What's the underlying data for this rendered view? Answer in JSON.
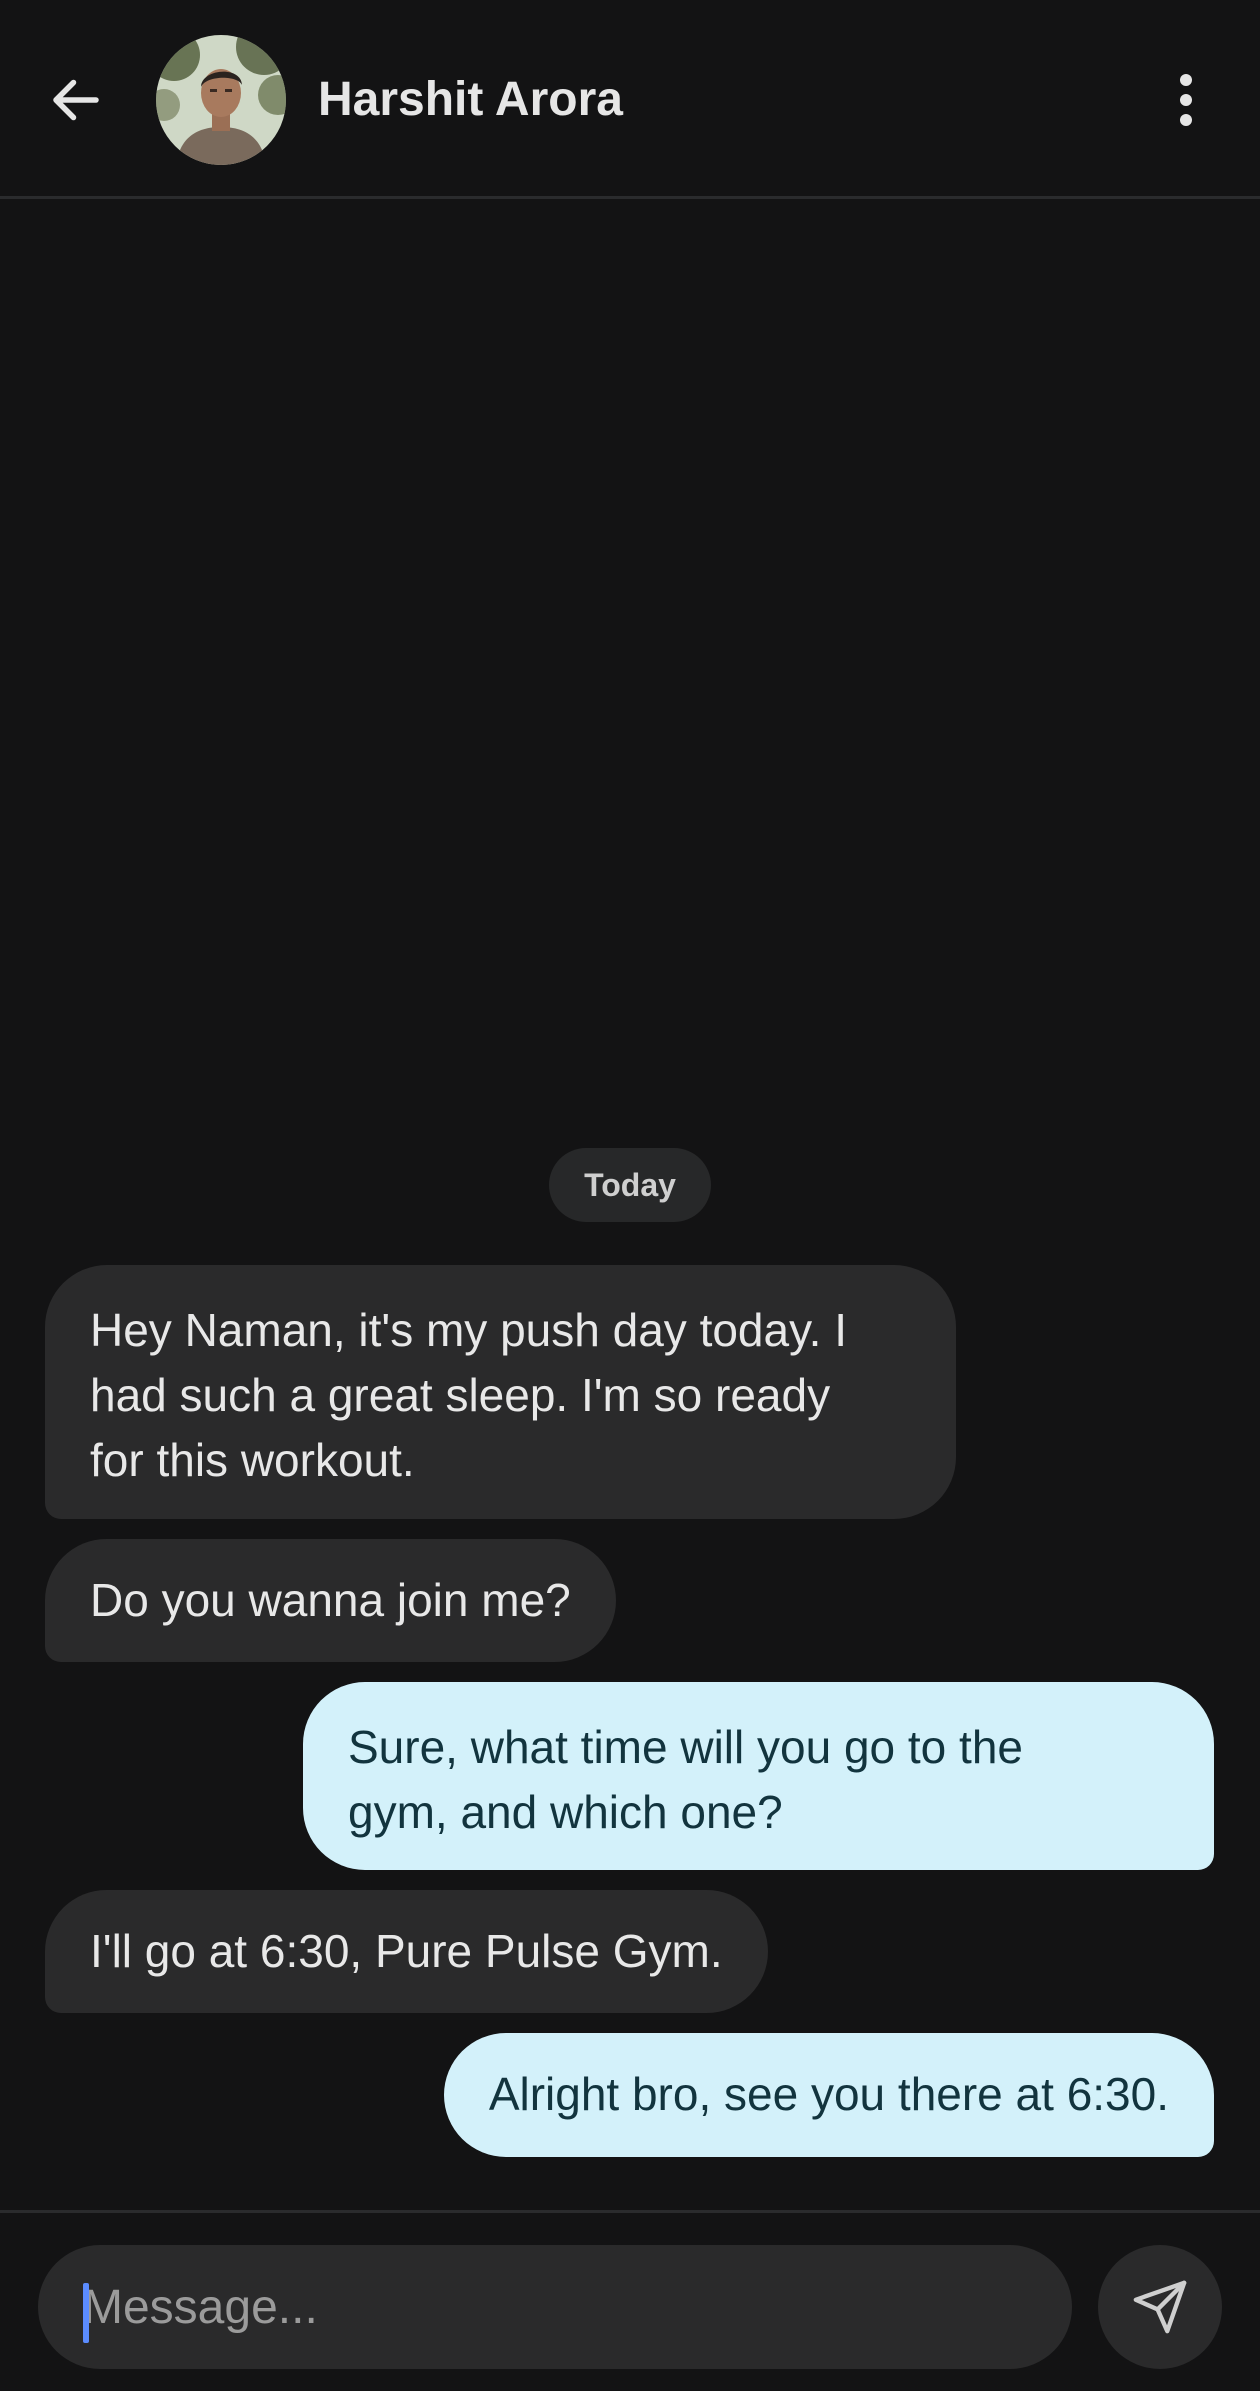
{
  "header": {
    "contact_name": "Harshit Arora",
    "back_icon": "arrow-left-icon",
    "menu_icon": "more-vertical-icon"
  },
  "chat": {
    "date_separator": "Today",
    "messages": [
      {
        "direction": "incoming",
        "text": "Hey Naman, it's my push day today. I\nhad such a great sleep. I'm so ready\nfor this workout."
      },
      {
        "direction": "incoming",
        "text": "Do you wanna join me?"
      },
      {
        "direction": "outgoing",
        "text": "Sure, what time will you go to the\ngym, and which one?"
      },
      {
        "direction": "incoming",
        "text": "I'll go at 6:30, Pure Pulse Gym."
      },
      {
        "direction": "outgoing",
        "text": "Alright bro, see you there at 6:30."
      }
    ]
  },
  "composer": {
    "placeholder": "Message...",
    "value": "",
    "send_icon": "send-icon"
  },
  "colors": {
    "background": "#131314",
    "incoming_bubble": "#2a2a2b",
    "outgoing_bubble": "#d3f1fa",
    "outgoing_text": "#12343e",
    "divider": "#2a2b2d",
    "caret": "#5b8cff"
  }
}
